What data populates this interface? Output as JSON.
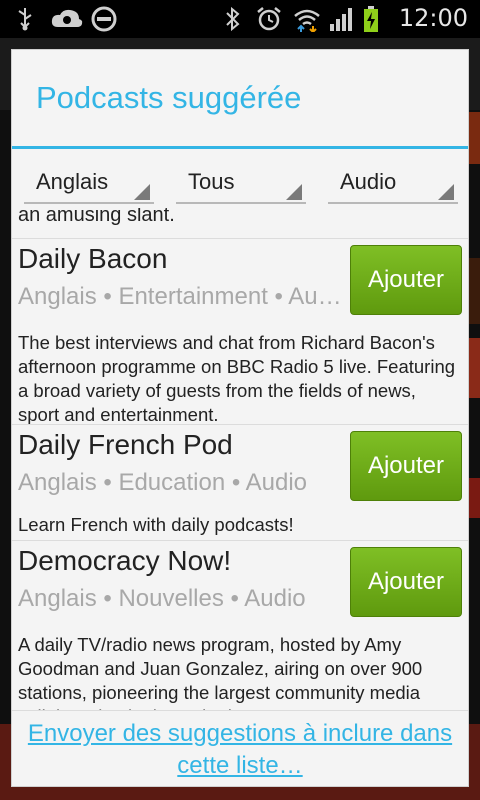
{
  "status_bar": {
    "time": "12:00",
    "icons": [
      "usb-icon",
      "cloud-sync-icon",
      "do-not-disturb-icon",
      "bluetooth-icon",
      "alarm-icon",
      "wifi-icon",
      "signal-icon",
      "battery-charging-icon"
    ]
  },
  "dialog": {
    "title": "Podcasts suggérée",
    "filters": [
      {
        "name": "language",
        "value": "Anglais"
      },
      {
        "name": "category",
        "value": "Tous"
      },
      {
        "name": "media",
        "value": "Audio"
      }
    ],
    "cutoff_text": "an amusing slant.",
    "items": [
      {
        "title": "Daily Bacon",
        "meta": "Anglais • Entertainment • Audio",
        "description": "The best interviews and chat from Richard Bacon's afternoon programme on BBC Radio 5 live. Featuring a broad variety of guests from the fields of news, sport and entertainment.",
        "button": "Ajouter"
      },
      {
        "title": "Daily French Pod",
        "meta": "Anglais • Education • Audio",
        "description": "Learn French with daily podcasts!",
        "button": "Ajouter"
      },
      {
        "title": "Democracy Now!",
        "meta": "Anglais • Nouvelles • Audio",
        "description": "A daily TV/radio news program, hosted by Amy Goodman and Juan Gonzalez, airing on over 900 stations, pioneering the largest community media collaboration in the United States.",
        "button": "Ajouter"
      }
    ],
    "footer_link": "Envoyer des suggestions à inclure dans cette liste…"
  },
  "colors": {
    "accent": "#33b5e5",
    "button_green": "#6aa815",
    "meta_gray": "#a8a8a8"
  }
}
